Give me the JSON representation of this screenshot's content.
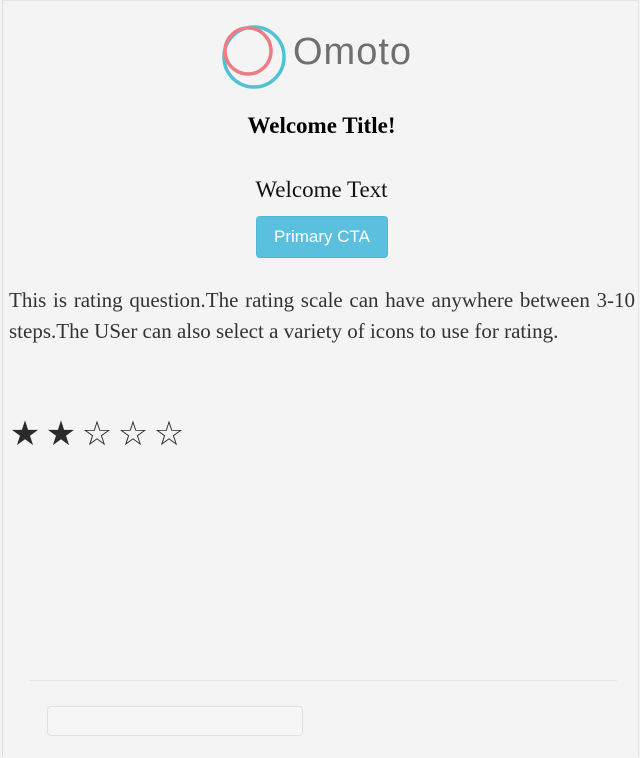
{
  "header": {
    "logo_text": "Omoto",
    "logo_icon": "omoto-rings-icon",
    "logo_colors": {
      "ring_pink": "#ee7b86",
      "ring_teal": "#4fc3d4",
      "text": "#6f6f6f"
    }
  },
  "welcome": {
    "title": "Welcome Title!",
    "text": "Welcome Text",
    "cta_label": "Primary CTA",
    "cta_color": "#5bc0de"
  },
  "question": {
    "text": "This is rating question.The rating scale can have anywhere between 3-10 steps.The USer can also select a variety of icons to use for rating.",
    "rating": {
      "max": 5,
      "value": 2,
      "filled_icon": "★",
      "empty_icon": "☆"
    }
  },
  "footer": {
    "input_value": "",
    "input_placeholder": ""
  }
}
